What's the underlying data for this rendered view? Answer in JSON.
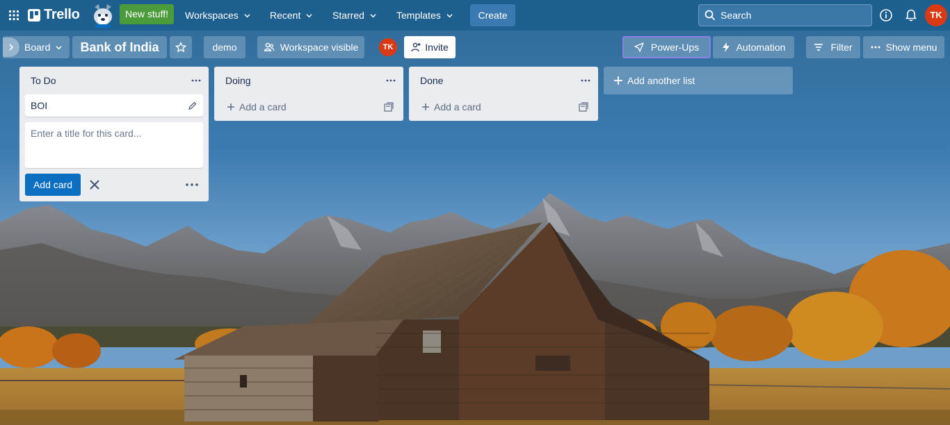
{
  "topnav": {
    "logo": "Trello",
    "new_stuff": "New stuff!",
    "workspaces": "Workspaces",
    "recent": "Recent",
    "starred": "Starred",
    "templates": "Templates",
    "create": "Create",
    "search_label": "Search",
    "avatar_initials": "TK"
  },
  "board_header": {
    "view": "Board",
    "title": "Bank of India",
    "workspace_name": "demo",
    "visibility": "Workspace visible",
    "member_initials": "TK",
    "invite": "Invite",
    "powerups": "Power-Ups",
    "automation": "Automation",
    "filter": "Filter",
    "show_menu": "Show menu"
  },
  "lists": [
    {
      "title": "To Do",
      "cards": [
        "BOI"
      ],
      "composer_placeholder": "Enter a title for this card...",
      "add_button": "Add card"
    },
    {
      "title": "Doing",
      "add_card": "Add a card"
    },
    {
      "title": "Done",
      "add_card": "Add a card"
    }
  ],
  "add_another_list": "Add another list",
  "colors": {
    "nav_bg": "#1d5f8e",
    "new_stuff_bg": "#4b9b3a",
    "avatar": "#d93a14",
    "primary_button": "#0b6fc1",
    "list_bg": "#ebecf0"
  }
}
